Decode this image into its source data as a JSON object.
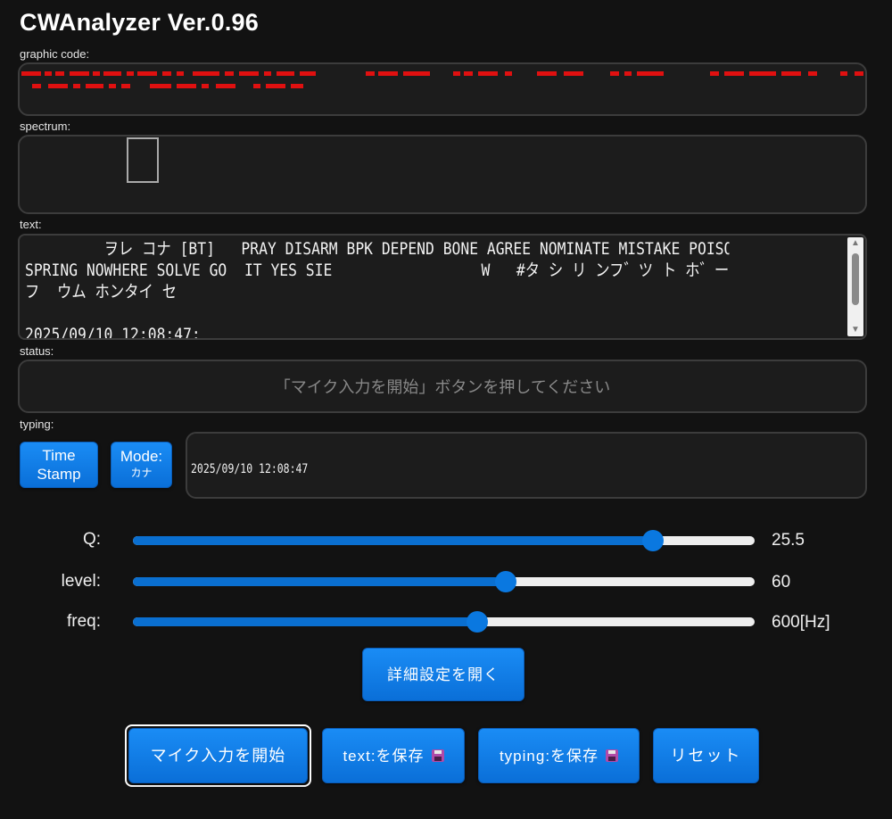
{
  "app": {
    "title": "CWAnalyzer Ver.0.96"
  },
  "labels": {
    "graphic_code": "graphic code:",
    "spectrum": "spectrum:",
    "text": "text:",
    "status": "status:",
    "typing": "typing:"
  },
  "text_panel": {
    "lines": [
      "         ヲレ コナ [BT]   PRAY DISARM BPK DEPEND BONE AGREE NOMINATE MISTAKE POISON",
      "SPRING NOWHERE SOLVE GO  IT YES SIE                 W   #タ シ リ ンフ゛ツ ト ホ゛ーン ホウシン ヒト ニンニク",
      "フ  ウム ホンタイ セ",
      "",
      "2025/09/10 12:08:47:"
    ]
  },
  "status_panel": {
    "message": "「マイク入力を開始」ボタンを押してください"
  },
  "typing_panel": {
    "timestamp_button": {
      "line1": "Time",
      "line2": "Stamp"
    },
    "mode_button": {
      "line1": "Mode:",
      "line2": "カナ"
    },
    "content": "2025/09/10 12:08:47"
  },
  "sliders": [
    {
      "label": "Q:",
      "value_text": "25.5",
      "fraction": 0.837
    },
    {
      "label": "level:",
      "value_text": "60",
      "fraction": 0.599
    },
    {
      "label": "freq:",
      "value_text": "600[Hz]",
      "fraction": 0.554
    }
  ],
  "buttons": {
    "details": "詳細設定を開く",
    "mic_start": "マイク入力を開始",
    "save_text": "text:を保存",
    "save_typing": "typing:を保存",
    "reset": "リセット"
  },
  "colors": {
    "accent": "#0a6fd8",
    "code_red": "#e01010",
    "background": "#121212"
  },
  "icons": {
    "save": "floppy-disk-icon"
  }
}
